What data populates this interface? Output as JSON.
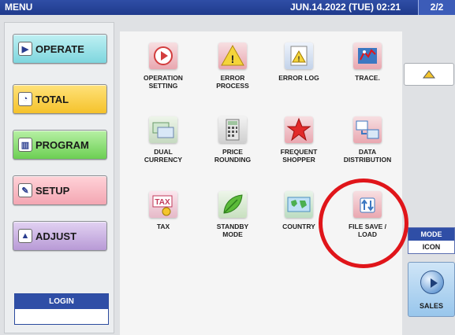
{
  "header": {
    "title": "MENU",
    "datetime": "JUN.14.2022 (TUE)  02:21",
    "page": "2/2"
  },
  "categories": [
    {
      "label": "OPERATE",
      "icon": "play-circle-icon"
    },
    {
      "label": "TOTAL",
      "icon": "clock-icon"
    },
    {
      "label": "PROGRAM",
      "icon": "book-icon"
    },
    {
      "label": "SETUP",
      "icon": "wrench-icon"
    },
    {
      "label": "ADJUST",
      "icon": "adjust-icon"
    }
  ],
  "login": {
    "label": "LOGIN"
  },
  "tiles": [
    {
      "label": "OPERATION\nSETTING",
      "icon": "operation-setting-icon"
    },
    {
      "label": "ERROR\nPROCESS",
      "icon": "warning-icon"
    },
    {
      "label": "ERROR LOG",
      "icon": "error-log-icon"
    },
    {
      "label": "TRACE.",
      "icon": "trace-icon"
    },
    {
      "label": "DUAL\nCURRENCY",
      "icon": "currency-icon"
    },
    {
      "label": "PRICE\nROUNDING",
      "icon": "calculator-icon"
    },
    {
      "label": "FREQUENT\nSHOPPER",
      "icon": "star-icon"
    },
    {
      "label": "DATA\nDISTRIBUTION",
      "icon": "data-distribution-icon"
    },
    {
      "label": "TAX",
      "icon": "tax-icon"
    },
    {
      "label": "STANDBY\nMODE",
      "icon": "leaf-icon"
    },
    {
      "label": "COUNTRY",
      "icon": "map-icon"
    },
    {
      "label": "FILE SAVE /\nLOAD",
      "icon": "file-save-load-icon"
    }
  ],
  "mode": {
    "label": "MODE",
    "value": "ICON"
  },
  "sales": {
    "label": "SALES"
  },
  "colors": {
    "header": "#2f4ea6",
    "highlight": "#e0151a"
  }
}
